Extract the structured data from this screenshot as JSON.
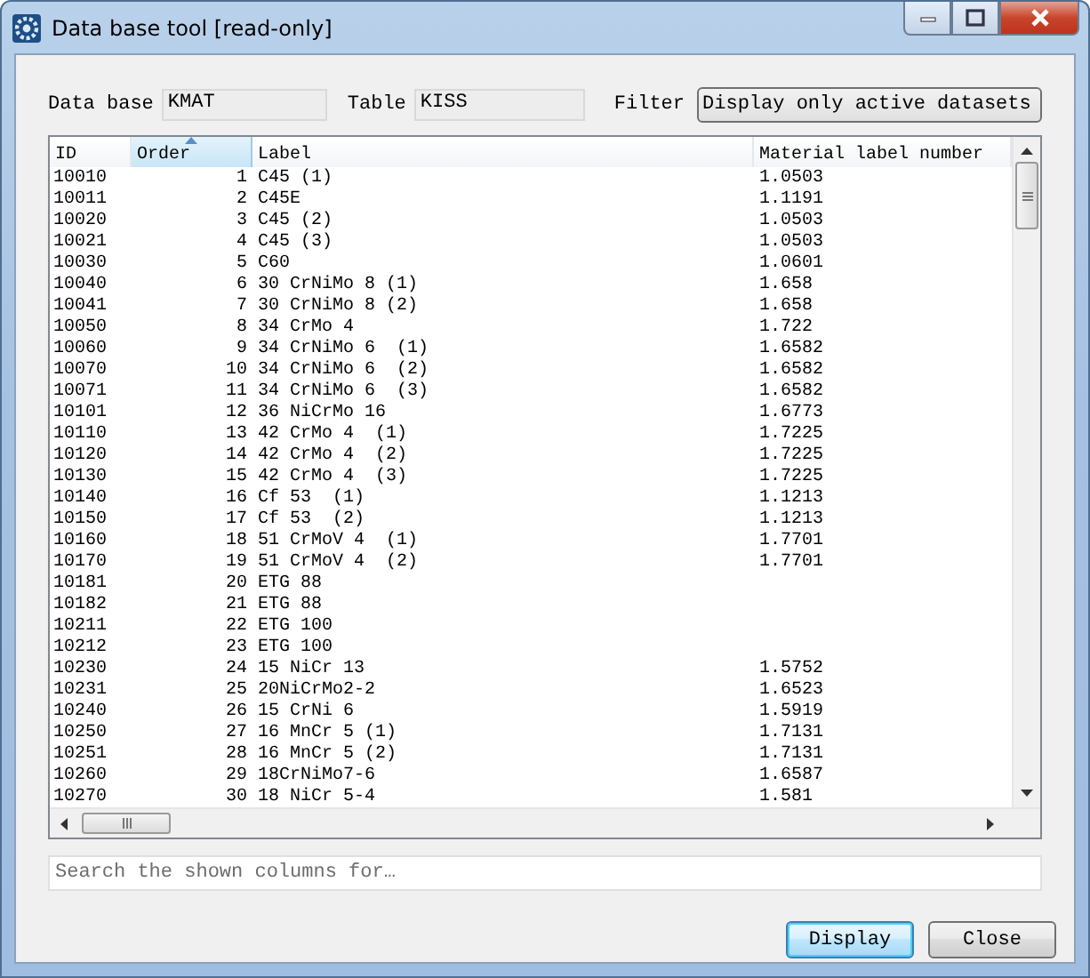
{
  "window": {
    "title": "Data base tool [read-only]"
  },
  "fields": [
    {
      "label": "Data base",
      "value": "KMAT"
    },
    {
      "label": "Table",
      "value": "KISS"
    }
  ],
  "filter": {
    "label": "Filter",
    "value": "Display only active datasets"
  },
  "table": {
    "columns": [
      {
        "label": "ID",
        "sorted": false
      },
      {
        "label": "Order",
        "sorted": true
      },
      {
        "label": "Label",
        "sorted": false
      },
      {
        "label": "Material label number",
        "sorted": false
      }
    ],
    "rows": [
      {
        "id": "10010",
        "order": "1",
        "label": "C45 (1)",
        "material": "1.0503"
      },
      {
        "id": "10011",
        "order": "2",
        "label": "C45E",
        "material": "1.1191"
      },
      {
        "id": "10020",
        "order": "3",
        "label": "C45 (2)",
        "material": "1.0503"
      },
      {
        "id": "10021",
        "order": "4",
        "label": "C45 (3)",
        "material": "1.0503"
      },
      {
        "id": "10030",
        "order": "5",
        "label": "C60",
        "material": "1.0601"
      },
      {
        "id": "10040",
        "order": "6",
        "label": "30 CrNiMo 8 (1)",
        "material": "1.658"
      },
      {
        "id": "10041",
        "order": "7",
        "label": "30 CrNiMo 8 (2)",
        "material": "1.658"
      },
      {
        "id": "10050",
        "order": "8",
        "label": "34 CrMo 4",
        "material": "1.722"
      },
      {
        "id": "10060",
        "order": "9",
        "label": "34 CrNiMo 6  (1)",
        "material": "1.6582"
      },
      {
        "id": "10070",
        "order": "10",
        "label": "34 CrNiMo 6  (2)",
        "material": "1.6582"
      },
      {
        "id": "10071",
        "order": "11",
        "label": "34 CrNiMo 6  (3)",
        "material": "1.6582"
      },
      {
        "id": "10101",
        "order": "12",
        "label": "36 NiCrMo 16",
        "material": "1.6773"
      },
      {
        "id": "10110",
        "order": "13",
        "label": "42 CrMo 4  (1)",
        "material": "1.7225"
      },
      {
        "id": "10120",
        "order": "14",
        "label": "42 CrMo 4  (2)",
        "material": "1.7225"
      },
      {
        "id": "10130",
        "order": "15",
        "label": "42 CrMo 4  (3)",
        "material": "1.7225"
      },
      {
        "id": "10140",
        "order": "16",
        "label": "Cf 53  (1)",
        "material": "1.1213"
      },
      {
        "id": "10150",
        "order": "17",
        "label": "Cf 53  (2)",
        "material": "1.1213"
      },
      {
        "id": "10160",
        "order": "18",
        "label": "51 CrMoV 4  (1)",
        "material": "1.7701"
      },
      {
        "id": "10170",
        "order": "19",
        "label": "51 CrMoV 4  (2)",
        "material": "1.7701"
      },
      {
        "id": "10181",
        "order": "20",
        "label": "ETG 88"
      },
      {
        "id": "10182",
        "order": "21",
        "label": "ETG 88"
      },
      {
        "id": "10211",
        "order": "22",
        "label": "ETG 100"
      },
      {
        "id": "10212",
        "order": "23",
        "label": "ETG 100"
      },
      {
        "id": "10230",
        "order": "24",
        "label": "15 NiCr 13",
        "material": "1.5752"
      },
      {
        "id": "10231",
        "order": "25",
        "label": "20NiCrMo2-2",
        "material": "1.6523"
      },
      {
        "id": "10240",
        "order": "26",
        "label": "15 CrNi 6",
        "material": "1.5919"
      },
      {
        "id": "10250",
        "order": "27",
        "label": "16 MnCr 5 (1)",
        "material": "1.7131"
      },
      {
        "id": "10251",
        "order": "28",
        "label": "16 MnCr 5 (2)",
        "material": "1.7131"
      },
      {
        "id": "10260",
        "order": "29",
        "label": "18CrNiMo7-6",
        "material": "1.6587"
      },
      {
        "id": "10270",
        "order": "30",
        "label": "18 NiCr 5-4",
        "material": "1.581"
      }
    ]
  },
  "search": {
    "placeholder": "Search the shown columns for…"
  },
  "buttons": [
    {
      "label": "Display",
      "default": true
    },
    {
      "label": "Close",
      "default": false
    }
  ]
}
